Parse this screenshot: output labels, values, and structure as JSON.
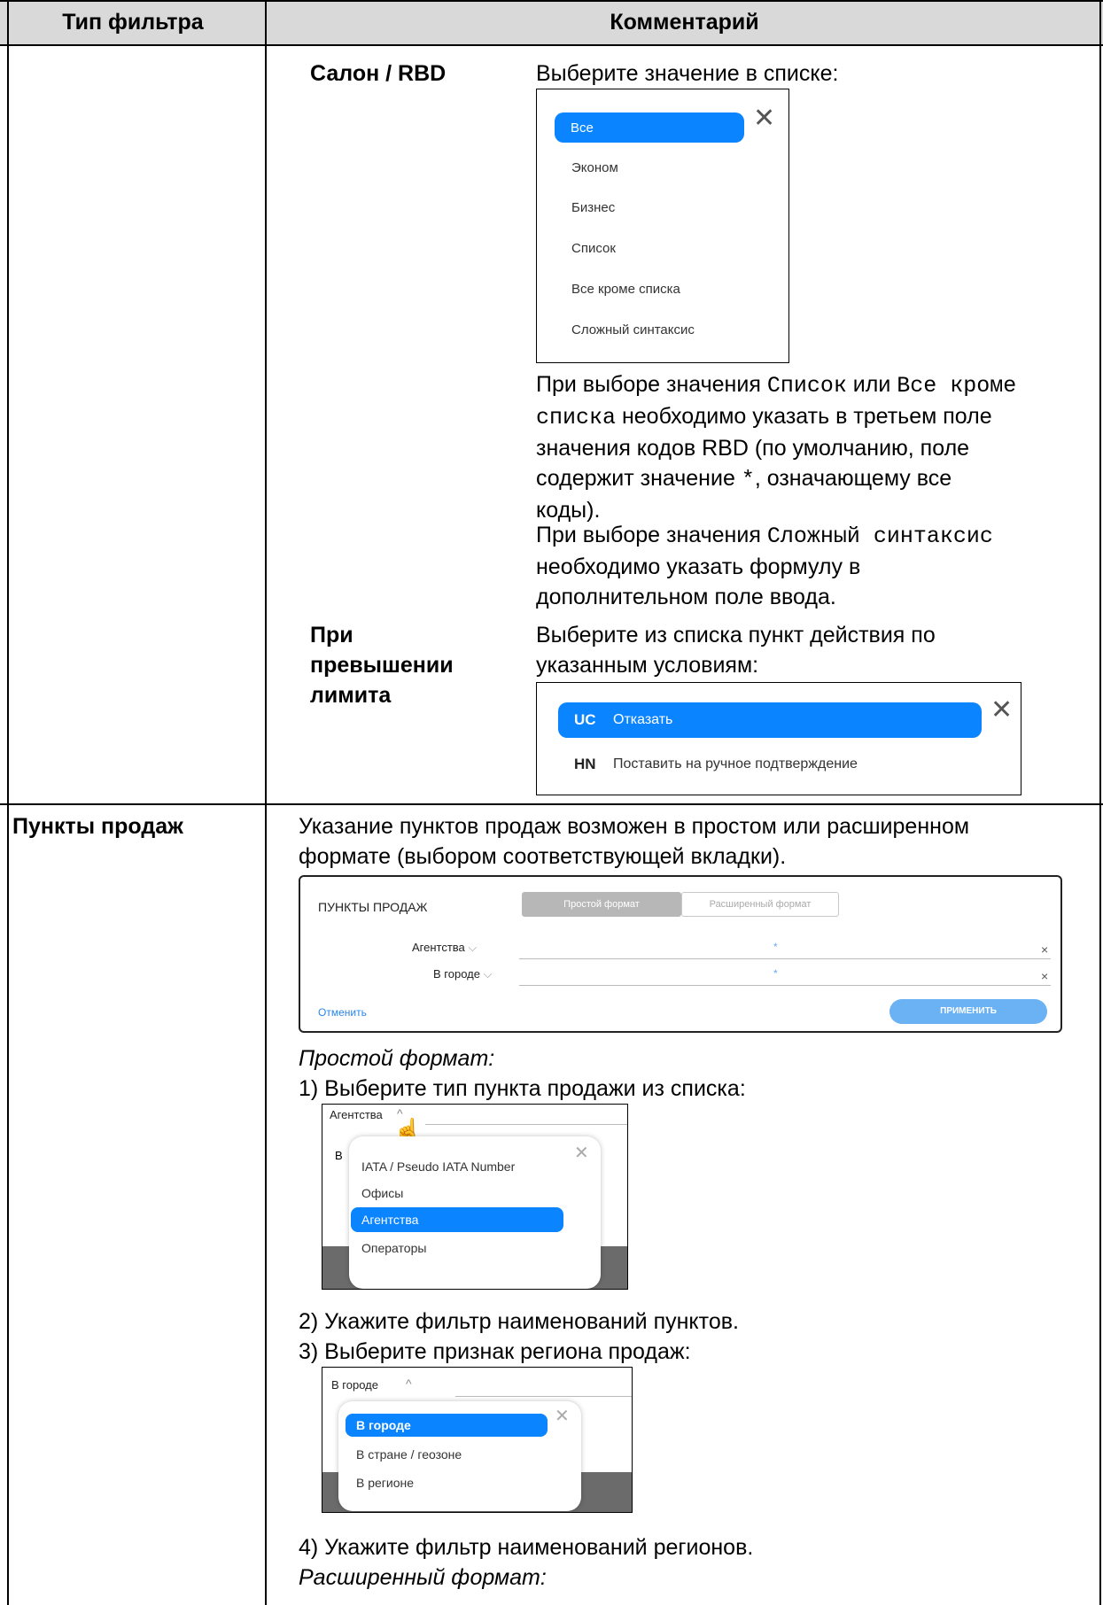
{
  "table": {
    "header": {
      "col1": "Тип фильтра",
      "col2": "Комментарий"
    }
  },
  "rbd": {
    "label": "Салон / RBD",
    "instruction": "Выберите значение в списке:",
    "options": [
      "Все",
      "Эконом",
      "Бизнес",
      "Список",
      "Все кроме списка",
      "Сложный синтаксис"
    ],
    "selected": "Все",
    "note1_a": "При выборе значения ",
    "note1_code1": "Список",
    "note1_or": " или ",
    "note1_code2a": "Все кроме",
    "note1_code2b": "списка",
    "note1_b": " необходимо указать в третьем поле",
    "note1_c": "значения кодов RBD (по умолчанию, поле",
    "note1_d1": "содержит значение ",
    "note1_star": "*",
    "note1_d2": ", означающему все",
    "note1_e": "коды).",
    "note2_a": "При выборе значения ",
    "note2_code": "Сложный синтаксис",
    "note2_b": "необходимо указать формулу в",
    "note2_c": "дополнительном поле ввода."
  },
  "limit": {
    "label_line1": "При",
    "label_line2": "превышении",
    "label_line3": "лимита",
    "instruction_line1": "Выберите из списка пункт действия по",
    "instruction_line2": "указанным условиям:",
    "options": [
      {
        "code": "UC",
        "label": "Отказать"
      },
      {
        "code": "HN",
        "label": "Поставить на ручное подтверждение"
      }
    ]
  },
  "sales": {
    "label": "Пункты продаж",
    "intro_line1": "Указание пунктов продаж возможен в простом или расширенном",
    "intro_line2": "формате (выбором соответствующей вкладки).",
    "panel": {
      "title": "ПУНКТЫ ПРОДАЖ",
      "tab_simple": "Простой формат",
      "tab_extended": "Расширенный формат",
      "row1_label": "Агентства",
      "row2_label": "В городе",
      "star": "*",
      "clear": "×",
      "cancel": "Отменить",
      "apply": "ПРИМЕНИТЬ"
    },
    "simple_heading": "Простой формат:",
    "step1": "1) Выберите тип пункта продажи из списка:",
    "types_shot": {
      "header": "Агентства",
      "behind_letter": "В",
      "options": [
        "IATA / Pseudo IATA Number",
        "Офисы",
        "Агентства",
        "Операторы"
      ],
      "selected": "Агентства"
    },
    "step2": "2) Укажите фильтр наименований пунктов.",
    "step3": "3) Выберите признак региона продаж:",
    "region_shot": {
      "header": "В городе",
      "options": [
        "В городе",
        "В стране / геозоне",
        "В регионе"
      ],
      "selected": "В городе"
    },
    "step4": "4) Укажите фильтр наименований регионов.",
    "extended_heading": "Расширенный формат:"
  }
}
